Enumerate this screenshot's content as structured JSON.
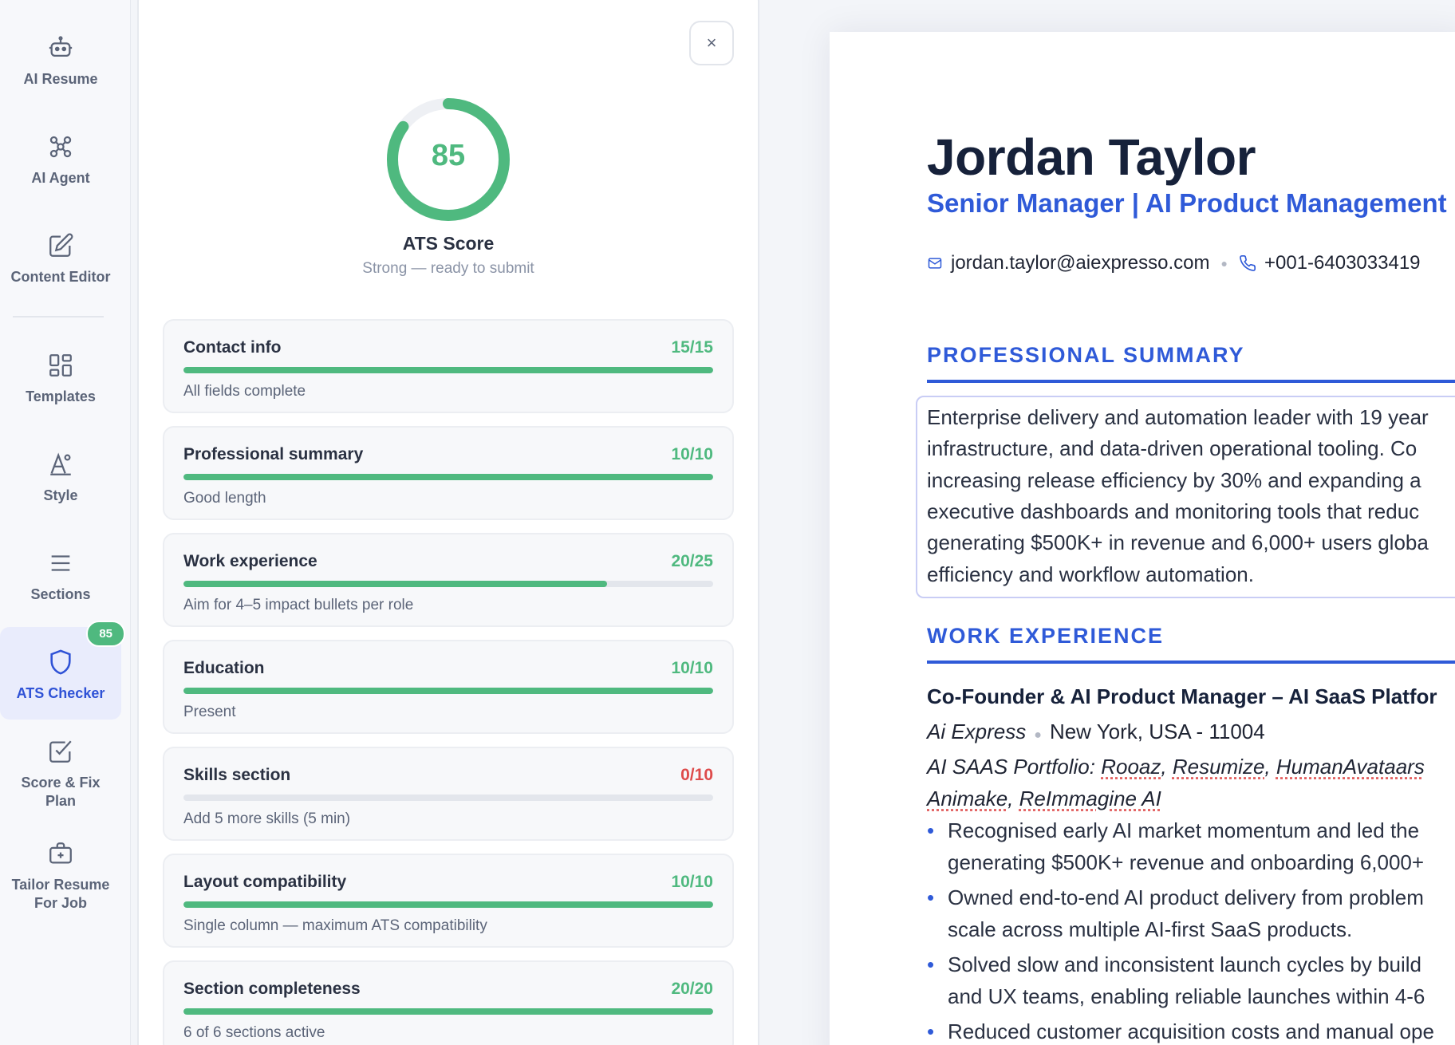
{
  "sidebar": {
    "items": [
      {
        "label": "AI Resume",
        "icon": "robot-icon"
      },
      {
        "label": "AI Agent",
        "icon": "agent-icon"
      },
      {
        "label": "Content Editor",
        "icon": "edit-icon"
      },
      {
        "label": "Templates",
        "icon": "templates-icon"
      },
      {
        "label": "Style",
        "icon": "style-icon"
      },
      {
        "label": "Sections",
        "icon": "sections-icon"
      },
      {
        "label": "ATS Checker",
        "icon": "shield-icon",
        "badge": "85",
        "active": true
      },
      {
        "label": "Score & Fix Plan",
        "icon": "check-square-icon"
      },
      {
        "label": "Tailor Resume For Job",
        "icon": "briefcase-icon"
      }
    ]
  },
  "ats": {
    "score": "85",
    "score_value": 85,
    "title": "ATS Score",
    "subtitle": "Strong — ready to submit",
    "close_label": "×",
    "colors": {
      "good": "#4fb97f",
      "bad": "#de4b4b"
    },
    "checks": [
      {
        "label": "Contact info",
        "score": "15/15",
        "fraction": 1.0,
        "note": "All fields complete"
      },
      {
        "label": "Professional summary",
        "score": "10/10",
        "fraction": 1.0,
        "note": "Good length"
      },
      {
        "label": "Work experience",
        "score": "20/25",
        "fraction": 0.8,
        "note": "Aim for 4–5 impact bullets per role"
      },
      {
        "label": "Education",
        "score": "10/10",
        "fraction": 1.0,
        "note": "Present"
      },
      {
        "label": "Skills section",
        "score": "0/10",
        "fraction": 0.0,
        "note": "Add 5 more skills (5 min)"
      },
      {
        "label": "Layout compatibility",
        "score": "10/10",
        "fraction": 1.0,
        "note": "Single column — maximum ATS compatibility"
      },
      {
        "label": "Section completeness",
        "score": "20/20",
        "fraction": 1.0,
        "note": "6 of 6 sections active"
      }
    ]
  },
  "resume": {
    "name": "Jordan Taylor",
    "title": "Senior Manager | AI Product Management",
    "email": "jordan.taylor@aiexpresso.com",
    "phone": "+001-6403033419",
    "summary_heading": "PROFESSIONAL SUMMARY",
    "summary_lines": [
      "Enterprise delivery and automation leader with 19 year",
      "infrastructure, and data-driven operational tooling. Co",
      "increasing release efficiency by 30% and expanding a",
      "executive dashboards and monitoring tools that reduc",
      "generating $500K+ in revenue and 6,000+ users globa",
      "efficiency and workflow automation."
    ],
    "experience_heading": "WORK EXPERIENCE",
    "job": {
      "title": "Co-Founder & AI Product Manager – AI SaaS Platfor",
      "company": "Ai Express",
      "location": "New York, USA - 11004",
      "portfolio_prefix": "AI SAAS Portfolio: ",
      "portfolio_line1_items": [
        "Rooaz",
        "Resumize",
        "HumanAvataars"
      ],
      "portfolio_line2_items": [
        "Animake",
        "ReImmagine AI"
      ],
      "bullets": [
        {
          "line1": "Recognised early AI market momentum and led the",
          "line2": "generating $500K+ revenue and onboarding 6,000+"
        },
        {
          "line1": "Owned end-to-end AI product delivery from problem",
          "line2": "scale across multiple AI-first SaaS products."
        },
        {
          "line1": "Solved slow and inconsistent launch cycles by build",
          "line2": "and UX teams, enabling reliable launches within 4-6"
        },
        {
          "line1": "Reduced customer acquisition costs and manual ope",
          "line2": ""
        }
      ]
    }
  }
}
